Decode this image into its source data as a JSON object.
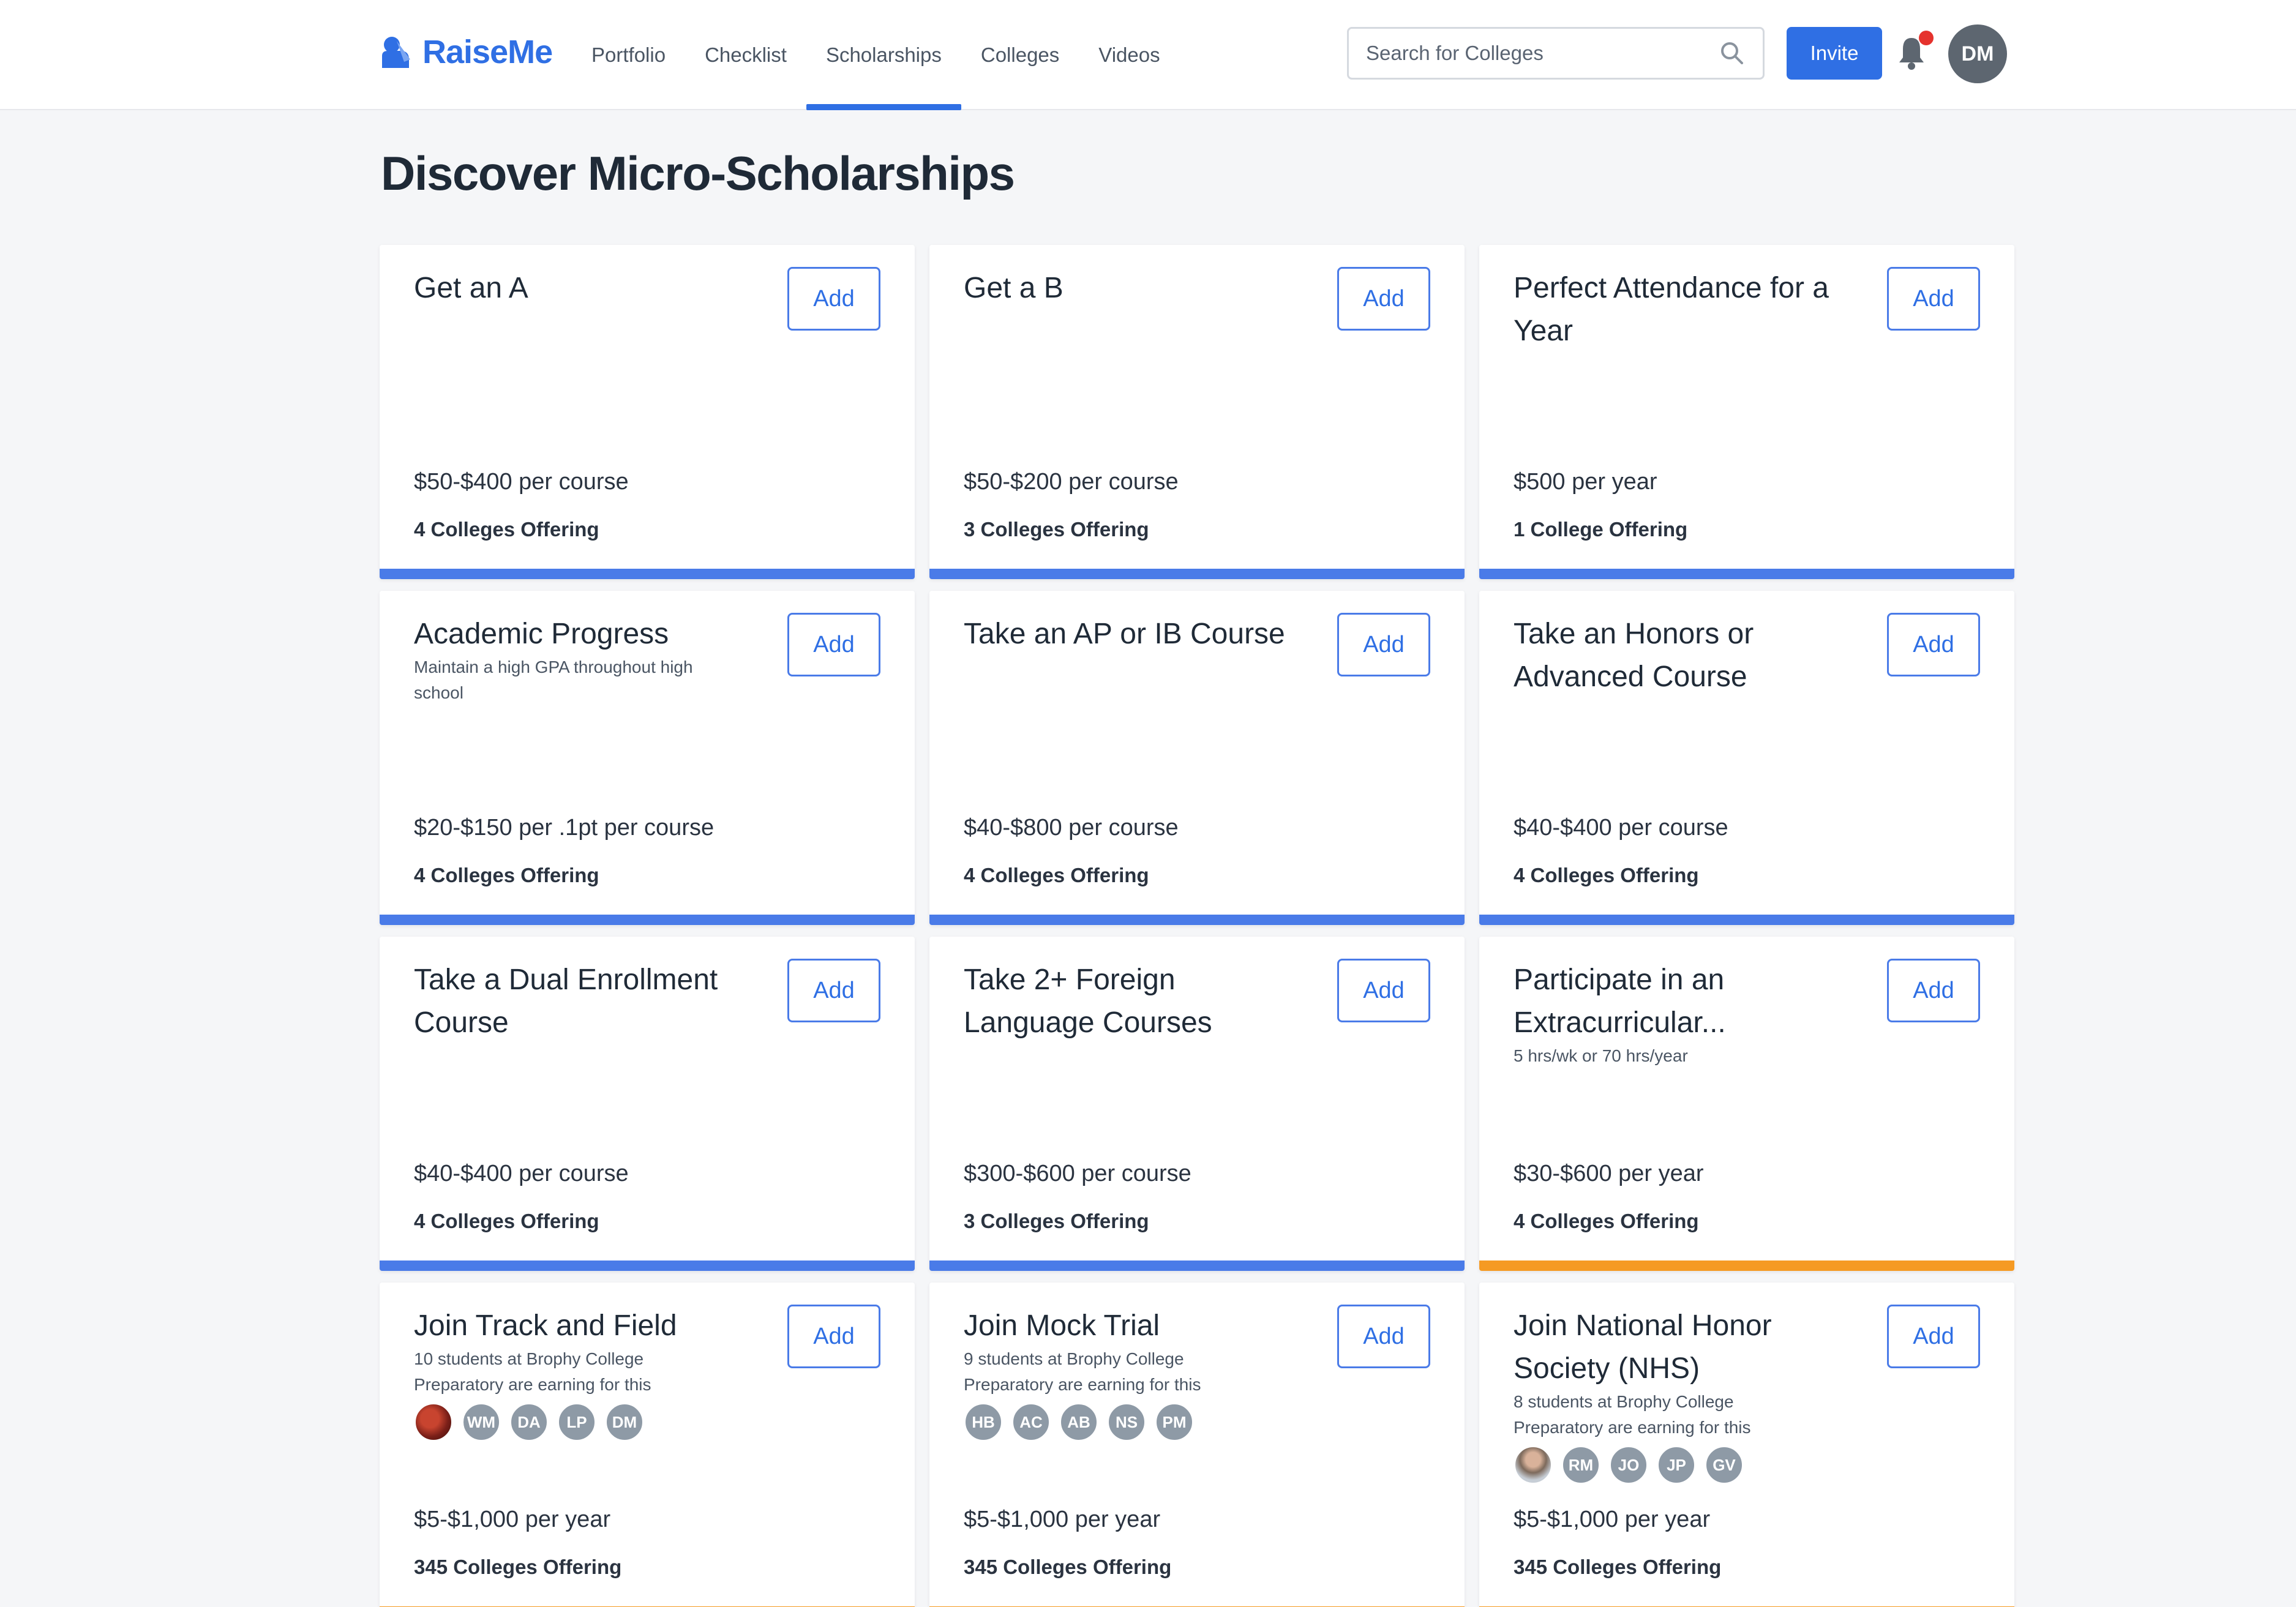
{
  "header": {
    "logo_text": "RaiseMe",
    "nav": [
      {
        "label": "Portfolio",
        "active": false
      },
      {
        "label": "Checklist",
        "active": false
      },
      {
        "label": "Scholarships",
        "active": true
      },
      {
        "label": "Colleges",
        "active": false
      },
      {
        "label": "Videos",
        "active": false
      }
    ],
    "search_placeholder": "Search for Colleges",
    "invite_label": "Invite",
    "user_initials": "DM",
    "accent_color": "#2f6fe4"
  },
  "page_title": "Discover Micro-Scholarships",
  "add_label": "Add",
  "cards": [
    {
      "title": "Get an A",
      "amount": "$50-$400 per course",
      "colleges": "4 Colleges Offering",
      "bar_color": "blue"
    },
    {
      "title": "Get a B",
      "amount": "$50-$200 per course",
      "colleges": "3 Colleges Offering",
      "bar_color": "blue"
    },
    {
      "title": "Perfect Attendance for a Year",
      "amount": "$500 per year",
      "colleges": "1 College Offering",
      "bar_color": "blue"
    },
    {
      "title": "Academic Progress",
      "subtitle": "Maintain a high GPA throughout high school",
      "amount": "$20-$150 per .1pt per course",
      "colleges": "4 Colleges Offering",
      "bar_color": "blue"
    },
    {
      "title": "Take an AP or IB Course",
      "amount": "$40-$800 per course",
      "colleges": "4 Colleges Offering",
      "bar_color": "blue"
    },
    {
      "title": "Take an Honors or Advanced Course",
      "amount": "$40-$400 per course",
      "colleges": "4 Colleges Offering",
      "bar_color": "blue"
    },
    {
      "title": "Take a Dual Enrollment Course",
      "amount": "$40-$400 per course",
      "colleges": "4 Colleges Offering",
      "bar_color": "blue"
    },
    {
      "title": "Take 2+ Foreign Language Courses",
      "amount": "$300-$600 per course",
      "colleges": "3 Colleges Offering",
      "bar_color": "blue"
    },
    {
      "title": "Participate in an Extracurricular...",
      "subtitle": "5 hrs/wk or 70 hrs/year",
      "amount": "$30-$600 per year",
      "colleges": "4 Colleges Offering",
      "bar_color": "orange"
    },
    {
      "title": "Join Track and Field",
      "subtitle": "10 students at Brophy College Preparatory are earning for this",
      "avatars": [
        "photo",
        "WM",
        "DA",
        "LP",
        "DM"
      ],
      "amount": "$5-$1,000 per year",
      "colleges": "345 Colleges Offering",
      "bar_color": "orange"
    },
    {
      "title": "Join Mock Trial",
      "subtitle": "9 students at Brophy College Preparatory are earning for this",
      "avatars": [
        "HB",
        "AC",
        "AB",
        "NS",
        "PM"
      ],
      "amount": "$5-$1,000 per year",
      "colleges": "345 Colleges Offering",
      "bar_color": "orange"
    },
    {
      "title": "Join National Honor Society (NHS)",
      "subtitle": "8 students at Brophy College Preparatory are earning for this",
      "avatars": [
        "photo",
        "RM",
        "JO",
        "JP",
        "GV"
      ],
      "amount": "$5-$1,000 per year",
      "colleges": "345 Colleges Offering",
      "bar_color": "orange"
    }
  ]
}
